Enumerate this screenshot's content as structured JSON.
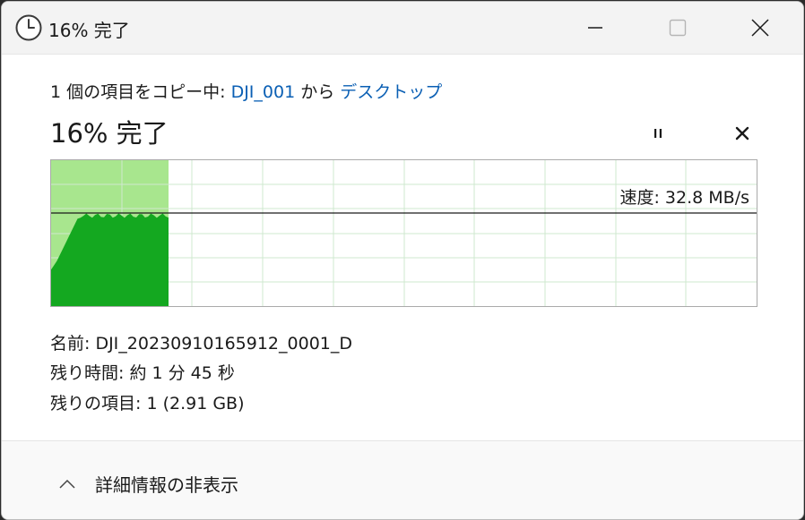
{
  "window": {
    "title": "16% 完了",
    "icons": {
      "app": "clock-icon",
      "minimize": "minimize-icon",
      "maximize": "maximize-icon",
      "close": "close-icon"
    }
  },
  "copy": {
    "prefix": "1 個の項目をコピー中: ",
    "source": "DJI_001",
    "middle": " から ",
    "destination": "デスクトップ"
  },
  "status": "16% 完了",
  "controls": {
    "pause_icon": "pause-icon",
    "cancel_icon": "cancel-icon"
  },
  "graph": {
    "speed": "速度: 32.8 MB/s",
    "progress": 0.16,
    "current_speed_fraction": 0.64,
    "colors": {
      "done_bg": "#a8e68e",
      "done_fill": "#14a820",
      "grid": "#cfe8cf",
      "speed_line": "#1a1a1a"
    }
  },
  "details": {
    "name": "名前: DJI_20230910165912_0001_D",
    "time_remaining": "残り時間: 約 1 分 45 秒",
    "items_remaining": "残りの項目: 1 (2.91 GB)"
  },
  "footer": {
    "toggle_label": "詳細情報の非表示",
    "toggle_icon": "chevron-up-icon"
  },
  "accent": "#0a5fb4"
}
